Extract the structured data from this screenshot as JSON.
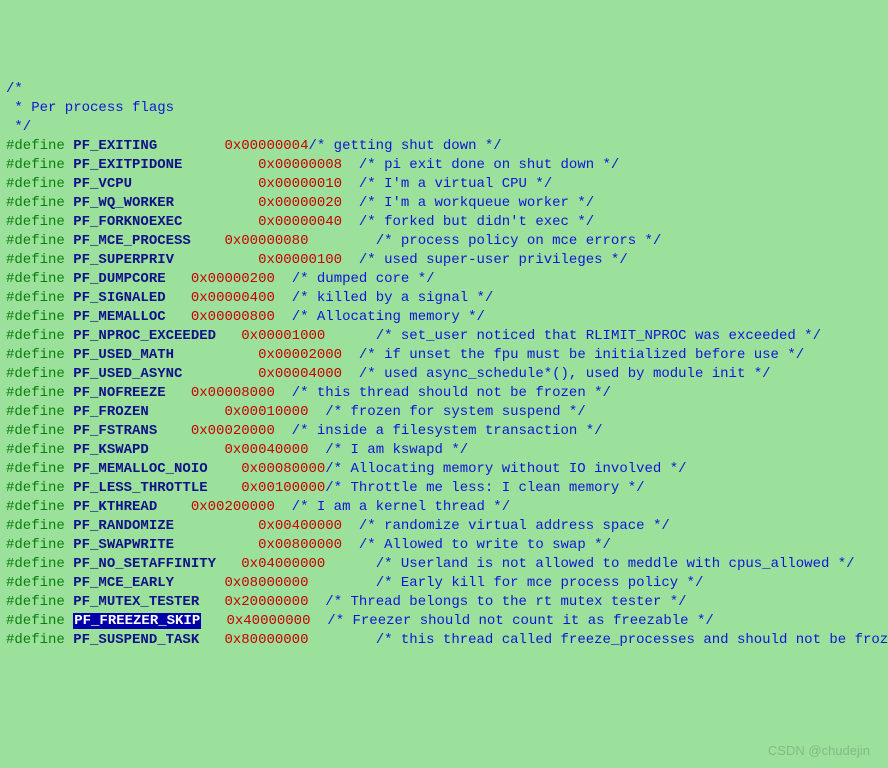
{
  "comment_header": {
    "l1": "/*",
    "l2": " * Per process flags",
    "l3": " */"
  },
  "kw": "#define",
  "rows": [
    {
      "name": "PF_EXITING",
      "val": "0x00000004",
      "c": "/* getting shut down */",
      "pad": 26,
      "vpad": 36
    },
    {
      "name": "PF_EXITPIDONE",
      "val": "0x00000008",
      "c": "/* pi exit done on shut down */",
      "pad": 30,
      "vpad": 42
    },
    {
      "name": "PF_VCPU",
      "val": "0x00000010",
      "c": "/* I'm a virtual CPU */",
      "pad": 30,
      "vpad": 42
    },
    {
      "name": "PF_WQ_WORKER",
      "val": "0x00000020",
      "c": "/* I'm a workqueue worker */",
      "pad": 30,
      "vpad": 42
    },
    {
      "name": "PF_FORKNOEXEC",
      "val": "0x00000040",
      "c": "/* forked but didn't exec */",
      "pad": 30,
      "vpad": 42
    },
    {
      "name": "PF_MCE_PROCESS",
      "val": "0x00000080",
      "c": "      /* process policy on mce errors */",
      "pad": 26,
      "vpad": 38
    },
    {
      "name": "PF_SUPERPRIV",
      "val": "0x00000100",
      "c": "/* used super-user privileges */",
      "pad": 30,
      "vpad": 42
    },
    {
      "name": "PF_DUMPCORE",
      "val": "0x00000200",
      "c": "/* dumped core */",
      "pad": 22,
      "vpad": 34
    },
    {
      "name": "PF_SIGNALED",
      "val": "0x00000400",
      "c": "/* killed by a signal */",
      "pad": 22,
      "vpad": 34
    },
    {
      "name": "PF_MEMALLOC",
      "val": "0x00000800",
      "c": "/* Allocating memory */",
      "pad": 22,
      "vpad": 34
    },
    {
      "name": "PF_NPROC_EXCEEDED",
      "val": "0x00001000",
      "c": "    /* set_user noticed that RLIMIT_NPROC was exceeded */",
      "pad": 28,
      "vpad": 40
    },
    {
      "name": "PF_USED_MATH",
      "val": "0x00002000",
      "c": "/* if unset the fpu must be initialized before use */",
      "pad": 30,
      "vpad": 42
    },
    {
      "name": "PF_USED_ASYNC",
      "val": "0x00004000",
      "c": "/* used async_schedule*(), used by module init */",
      "pad": 30,
      "vpad": 42
    },
    {
      "name": "PF_NOFREEZE",
      "val": "0x00008000",
      "c": "/* this thread should not be frozen */",
      "pad": 22,
      "vpad": 34
    },
    {
      "name": "PF_FROZEN",
      "val": "0x00010000",
      "c": "/* frozen for system suspend */",
      "pad": 26,
      "vpad": 38
    },
    {
      "name": "PF_FSTRANS",
      "val": "0x00020000",
      "c": "/* inside a filesystem transaction */",
      "pad": 22,
      "vpad": 34
    },
    {
      "name": "PF_KSWAPD",
      "val": "0x00040000",
      "c": "/* I am kswapd */",
      "pad": 26,
      "vpad": 38
    },
    {
      "name": "PF_MEMALLOC_NOIO",
      "val": "0x00080000",
      "c": "/* Allocating memory without IO involved */",
      "pad": 28,
      "vpad": 38
    },
    {
      "name": "PF_LESS_THROTTLE",
      "val": "0x00100000",
      "c": "/* Throttle me less: I clean memory */",
      "pad": 28,
      "vpad": 38
    },
    {
      "name": "PF_KTHREAD",
      "val": "0x00200000",
      "c": "/* I am a kernel thread */",
      "pad": 22,
      "vpad": 34
    },
    {
      "name": "PF_RANDOMIZE",
      "val": "0x00400000",
      "c": "/* randomize virtual address space */",
      "pad": 30,
      "vpad": 42
    },
    {
      "name": "PF_SWAPWRITE",
      "val": "0x00800000",
      "c": "/* Allowed to write to swap */",
      "pad": 30,
      "vpad": 42
    },
    {
      "name": "PF_NO_SETAFFINITY",
      "val": "0x04000000",
      "c": "    /* Userland is not allowed to meddle with cpus_allowed */",
      "pad": 28,
      "vpad": 40
    },
    {
      "name": "PF_MCE_EARLY",
      "val": "0x08000000",
      "c": "      /* Early kill for mce process policy */",
      "pad": 26,
      "vpad": 38
    },
    {
      "name": "PF_MUTEX_TESTER",
      "val": "0x20000000",
      "c": "/* Thread belongs to the rt mutex tester */",
      "pad": 26,
      "vpad": 38
    },
    {
      "name": "PF_FREEZER_SKIP",
      "val": "0x40000000",
      "c": "/* Freezer should not count it as freezable */",
      "pad": 26,
      "vpad": 38,
      "hl": true
    },
    {
      "name": "PF_SUSPEND_TASK",
      "val": "0x80000000",
      "c": "      /* this thread called freeze_processes and should not be frozen */",
      "pad": 26,
      "vpad": 38
    }
  ],
  "watermark": "CSDN @chudejin"
}
